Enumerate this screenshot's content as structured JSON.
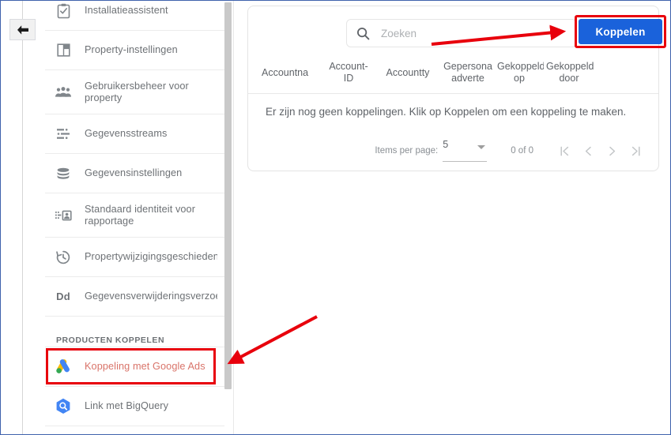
{
  "colors": {
    "accent_blue": "#1a62db",
    "annotation_red": "#e8000c",
    "selected_item_text": "#d9746a",
    "nav_text": "#6d7175",
    "muted_text": "#8a8f94"
  },
  "left_rail": {
    "back_button_label": "back-arrow"
  },
  "sidebar": {
    "items": [
      {
        "label": "Installatieassistent",
        "icon": "clipboard-check-icon",
        "selected": false
      },
      {
        "label": "Property-instellingen",
        "icon": "layout-icon",
        "selected": false
      },
      {
        "label": "Gebruikersbeheer voor property",
        "icon": "people-group-icon",
        "selected": false
      },
      {
        "label": "Gegevensstreams",
        "icon": "data-streams-icon",
        "selected": false
      },
      {
        "label": "Gegevensinstellingen",
        "icon": "database-icon",
        "selected": false
      },
      {
        "label": "Standaard identiteit voor rapportage",
        "icon": "identity-card-icon",
        "selected": false
      },
      {
        "label": "Propertywijzigingsgeschieden",
        "icon": "history-clock-icon",
        "selected": false
      },
      {
        "label": "Gegevensverwijderingsverzoek",
        "icon": "dd-glyph-icon",
        "selected": false
      }
    ],
    "section_label": "PRODUCTEN KOPPELEN",
    "product_items": [
      {
        "label": "Koppeling met Google Ads",
        "icon": "google-ads-icon",
        "selected": true
      },
      {
        "label": "Link met BigQuery",
        "icon": "bigquery-icon",
        "selected": false
      }
    ]
  },
  "main": {
    "search": {
      "placeholder": "Zoeken",
      "value": ""
    },
    "link_button_label": "Koppelen",
    "table": {
      "headers": [
        "Accountna",
        "Account-ID",
        "Accountty",
        "Gepersona adverte",
        "Gekoppeld op",
        "Gekoppeld door"
      ],
      "empty_message": "Er zijn nog geen koppelingen. Klik op Koppelen om een koppeling te maken."
    },
    "paginator": {
      "items_per_page_label": "Items per page:",
      "page_size": "5",
      "range_label": "0 of 0",
      "first_page_icon": "first-page-icon",
      "prev_page_icon": "chevron-left-icon",
      "next_page_icon": "chevron-right-icon",
      "last_page_icon": "last-page-icon"
    }
  }
}
